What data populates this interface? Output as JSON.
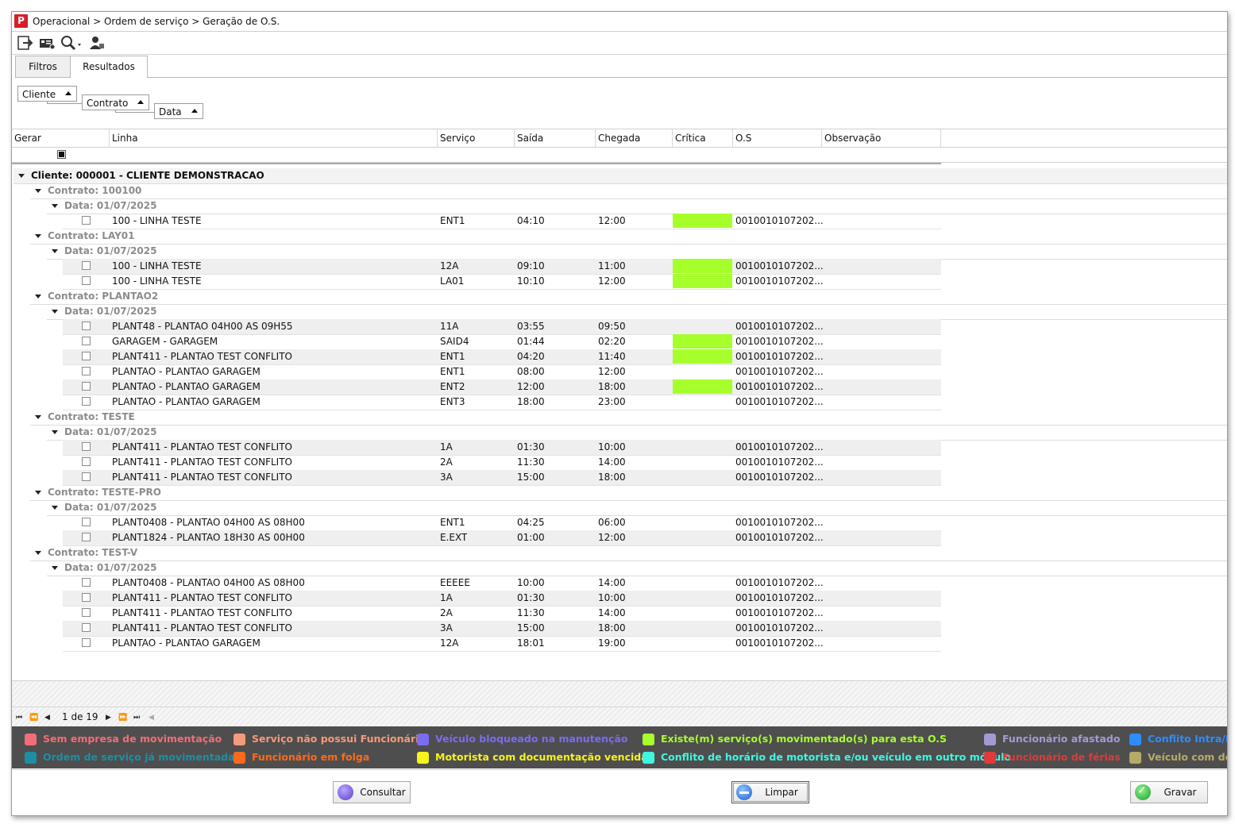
{
  "breadcrumb": "Operacional > Ordem de serviço > Geração de O.S.",
  "toolbar": {
    "icons": [
      "exit-icon",
      "vehicle-card-icon",
      "search-dropdown-icon",
      "user-icon"
    ]
  },
  "tabs": [
    {
      "label": "Filtros",
      "active": false
    },
    {
      "label": "Resultados",
      "active": true
    }
  ],
  "grouping": [
    "Cliente",
    "Contrato",
    "Data"
  ],
  "columns": [
    "Gerar",
    "Linha",
    "Serviço",
    "Saída",
    "Chegada",
    "Crítica",
    "O.S",
    "Observação"
  ],
  "rows": [
    {
      "kind": "group",
      "level": 0,
      "text": "Cliente: 000001 - CLIENTE DEMONSTRACAO"
    },
    {
      "kind": "group",
      "level": 1,
      "text": "Contrato: 100100"
    },
    {
      "kind": "group",
      "level": 2,
      "text": "Data: 01/07/2025"
    },
    {
      "kind": "data",
      "linha": "100 - LINHA TESTE",
      "servico": "ENT1",
      "saida": "04:10",
      "chegada": "12:00",
      "critica": true,
      "os": "0010010107202..."
    },
    {
      "kind": "group",
      "level": 1,
      "text": "Contrato: LAY01"
    },
    {
      "kind": "group",
      "level": 2,
      "text": "Data: 01/07/2025"
    },
    {
      "kind": "data",
      "linha": "100 - LINHA TESTE",
      "servico": "12A",
      "saida": "09:10",
      "chegada": "11:00",
      "critica": true,
      "os": "0010010107202..."
    },
    {
      "kind": "data",
      "linha": "100 - LINHA TESTE",
      "servico": "LA01",
      "saida": "10:10",
      "chegada": "12:00",
      "critica": true,
      "os": "0010010107202..."
    },
    {
      "kind": "group",
      "level": 1,
      "text": "Contrato: PLANTAO2"
    },
    {
      "kind": "group",
      "level": 2,
      "text": "Data: 01/07/2025"
    },
    {
      "kind": "data",
      "linha": "PLANT48 - PLANTAO 04H00 AS 09H55",
      "servico": "11A",
      "saida": "03:55",
      "chegada": "09:50",
      "critica": false,
      "os": "0010010107202..."
    },
    {
      "kind": "data",
      "linha": "GARAGEM - GARAGEM",
      "servico": "SAID4",
      "saida": "01:44",
      "chegada": "02:20",
      "critica": true,
      "os": "0010010107202..."
    },
    {
      "kind": "data",
      "linha": "PLANT411 - PLANTAO TEST CONFLITO",
      "servico": "ENT1",
      "saida": "04:20",
      "chegada": "11:40",
      "critica": true,
      "os": "0010010107202..."
    },
    {
      "kind": "data",
      "linha": "PLANTAO - PLANTAO GARAGEM",
      "servico": "ENT1",
      "saida": "08:00",
      "chegada": "12:00",
      "critica": false,
      "os": "0010010107202..."
    },
    {
      "kind": "data",
      "linha": "PLANTAO - PLANTAO GARAGEM",
      "servico": "ENT2",
      "saida": "12:00",
      "chegada": "18:00",
      "critica": true,
      "os": "0010010107202..."
    },
    {
      "kind": "data",
      "linha": "PLANTAO - PLANTAO GARAGEM",
      "servico": "ENT3",
      "saida": "18:00",
      "chegada": "23:00",
      "critica": false,
      "os": "0010010107202..."
    },
    {
      "kind": "group",
      "level": 1,
      "text": "Contrato: TESTE"
    },
    {
      "kind": "group",
      "level": 2,
      "text": "Data: 01/07/2025"
    },
    {
      "kind": "data",
      "linha": "PLANT411 - PLANTAO TEST CONFLITO",
      "servico": "1A",
      "saida": "01:30",
      "chegada": "10:00",
      "critica": false,
      "os": "0010010107202..."
    },
    {
      "kind": "data",
      "linha": "PLANT411 - PLANTAO TEST CONFLITO",
      "servico": "2A",
      "saida": "11:30",
      "chegada": "14:00",
      "critica": false,
      "os": "0010010107202..."
    },
    {
      "kind": "data",
      "linha": "PLANT411 - PLANTAO TEST CONFLITO",
      "servico": "3A",
      "saida": "15:00",
      "chegada": "18:00",
      "critica": false,
      "os": "0010010107202..."
    },
    {
      "kind": "group",
      "level": 1,
      "text": "Contrato: TESTE-PRO"
    },
    {
      "kind": "group",
      "level": 2,
      "text": "Data: 01/07/2025"
    },
    {
      "kind": "data",
      "linha": "PLANT0408 - PLANTAO 04H00 AS 08H00",
      "servico": "ENT1",
      "saida": "04:25",
      "chegada": "06:00",
      "critica": false,
      "os": "0010010107202..."
    },
    {
      "kind": "data",
      "linha": "PLANT1824 - PLANTAO 18H30 AS 00H00",
      "servico": "E.EXT",
      "saida": "01:00",
      "chegada": "12:00",
      "critica": false,
      "os": "0010010107202..."
    },
    {
      "kind": "group",
      "level": 1,
      "text": "Contrato: TEST-V"
    },
    {
      "kind": "group",
      "level": 2,
      "text": "Data: 01/07/2025"
    },
    {
      "kind": "data",
      "linha": "PLANT0408 - PLANTAO 04H00 AS 08H00",
      "servico": "EEEEE",
      "saida": "10:00",
      "chegada": "14:00",
      "critica": false,
      "os": "0010010107202..."
    },
    {
      "kind": "data",
      "linha": "PLANT411 - PLANTAO TEST CONFLITO",
      "servico": "1A",
      "saida": "01:30",
      "chegada": "10:00",
      "critica": false,
      "os": "0010010107202..."
    },
    {
      "kind": "data",
      "linha": "PLANT411 - PLANTAO TEST CONFLITO",
      "servico": "2A",
      "saida": "11:30",
      "chegada": "14:00",
      "critica": false,
      "os": "0010010107202..."
    },
    {
      "kind": "data",
      "linha": "PLANT411 - PLANTAO TEST CONFLITO",
      "servico": "3A",
      "saida": "15:00",
      "chegada": "18:00",
      "critica": false,
      "os": "0010010107202..."
    },
    {
      "kind": "data",
      "linha": "PLANTAO - PLANTAO GARAGEM",
      "servico": "12A",
      "saida": "18:01",
      "chegada": "19:00",
      "critica": false,
      "os": "0010010107202..."
    }
  ],
  "pager": {
    "text": "1 de 19"
  },
  "legend": [
    {
      "label": "Sem empresa de movimentação",
      "color": "#f26d78"
    },
    {
      "label": "Serviço não possui Funcionário",
      "color": "#f59a7a"
    },
    {
      "label": "Veículo bloqueado na manutenção",
      "color": "#7b6cf0"
    },
    {
      "label": "Existe(m) serviço(s) movimentado(s) para esta O.S",
      "color": "#a6ff2b"
    },
    {
      "label": "Funcionário afastado",
      "color": "#a49ad3"
    },
    {
      "label": "Conflito Intra/Inter",
      "color": "#2d8cff"
    },
    {
      "label": "Ordem de serviço já movimentada",
      "color": "#1d8fa3"
    },
    {
      "label": "Funcionário em folga",
      "color": "#ff6a1a"
    },
    {
      "label": "Motorista com documentação vencida",
      "color": "#f7f31c"
    },
    {
      "label": "Conflito de horário de motorista e/ou veículo em outro módulo",
      "color": "#3ff7e0"
    },
    {
      "label": "Funcionário de férias",
      "color": "#e03a3a"
    },
    {
      "label": "Veículo com docum",
      "color": "#b5ab68"
    }
  ],
  "buttons": {
    "consultar": "Consultar",
    "limpar": "Limpar",
    "gravar": "Gravar"
  }
}
